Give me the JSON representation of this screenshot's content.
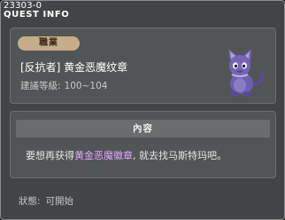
{
  "window": {
    "id": "23303-0",
    "title": "QUEST INFO"
  },
  "job": {
    "badge": "職業",
    "name": "[反抗者] 黄金恶魔纹章",
    "level_label": "建議等級:",
    "level_range": "100~104"
  },
  "content": {
    "header": "內容",
    "text_before": "要想再获得",
    "text_highlight": "黄金恶魔徽章",
    "text_after": ", 就去找马斯特玛吧。"
  },
  "status": {
    "label": "狀態:",
    "value": "可開始"
  },
  "colors": {
    "highlight": "#e0a7ff",
    "badge": "#c7ac8c",
    "character": "#6f5fb0"
  },
  "icons": {
    "character": "purple-cat-character-icon"
  }
}
